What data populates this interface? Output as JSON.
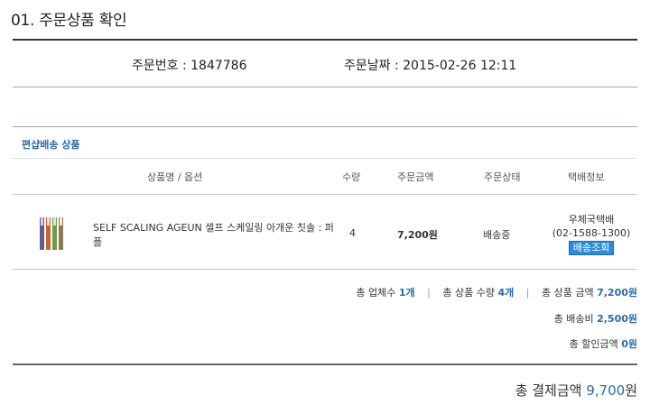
{
  "section": {
    "title": "01. 주문상품 확인"
  },
  "order": {
    "number_label": "주문번호 : 1847786",
    "date_label": "주문날짜 : 2015-02-26 12:11"
  },
  "shipping_group": {
    "title": "편샵배송 상품"
  },
  "table": {
    "headers": {
      "product": "상품명 / 옵션",
      "qty": "수량",
      "price": "주문금액",
      "status": "주문상태",
      "delivery": "택배정보"
    },
    "rows": [
      {
        "name": "SELF SCALING AGEUN 셀프 스케일링 아개운 칫솔 : 퍼플",
        "qty": "4",
        "price": "7,200원",
        "status": "배송중",
        "carrier": "우체국택배",
        "tracking": "(02-1588-1300)",
        "track_button": "배송조회"
      }
    ]
  },
  "summary": {
    "vendor_label": "총 업체수 ",
    "vendor_value": "1개",
    "qty_label": "총 상품 수량 ",
    "qty_value": "4개",
    "amount_label": "총 상품 금액 ",
    "amount_value": "7,200원",
    "shipping_label": "총 배송비 ",
    "shipping_value": "2,500원",
    "discount_label": "총 할인금액 ",
    "discount_value": "0원",
    "separator": "|"
  },
  "grand_total": {
    "label": "총 결제금액 ",
    "value": "9,700",
    "unit": "원"
  },
  "colors": {
    "accent": "#2a6ba8",
    "button": "#2d8bd6"
  }
}
